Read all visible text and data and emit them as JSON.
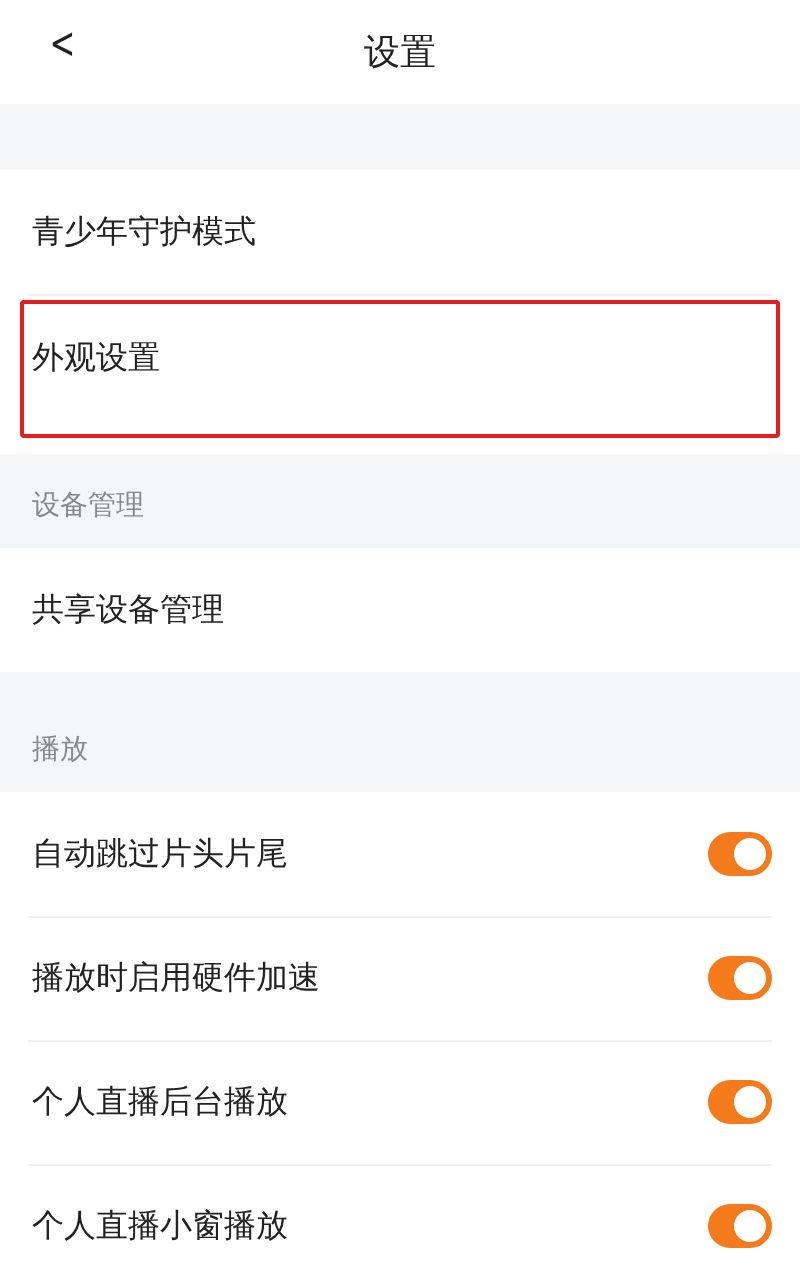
{
  "header": {
    "back": "<",
    "title": "设置"
  },
  "sections": [
    {
      "items": [
        {
          "kind": "link",
          "label": "青少年守护模式",
          "highlighted": false
        },
        {
          "kind": "link",
          "label": "外观设置",
          "highlighted": true
        }
      ]
    },
    {
      "title": "设备管理",
      "items": [
        {
          "kind": "link",
          "label": "共享设备管理",
          "highlighted": false
        }
      ]
    },
    {
      "title": "播放",
      "items": [
        {
          "kind": "toggle",
          "label": "自动跳过片头片尾",
          "on": true
        },
        {
          "kind": "toggle",
          "label": "播放时启用硬件加速",
          "on": true
        },
        {
          "kind": "toggle",
          "label": "个人直播后台播放",
          "on": true
        },
        {
          "kind": "toggle",
          "label": "个人直播小窗播放",
          "on": true
        }
      ]
    }
  ]
}
